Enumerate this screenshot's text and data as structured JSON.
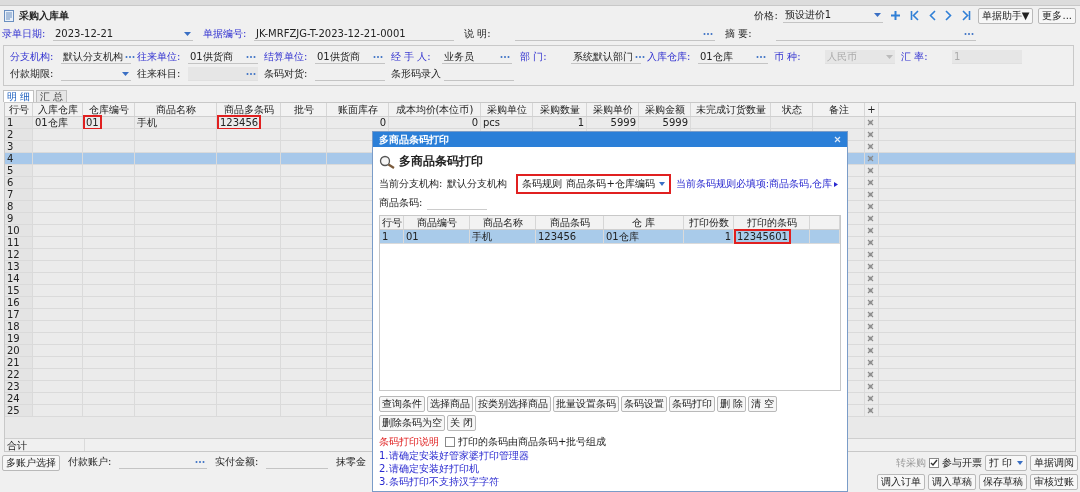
{
  "window": {
    "title": "采购入库单"
  },
  "toolbar": {
    "price_label": "价格:",
    "price_value": "预设进价1",
    "buttons": [
      "单据助手▼",
      "更多..."
    ]
  },
  "header_fields": [
    {
      "label": "录单日期:",
      "value": "2023-12-21",
      "kind": "dropdown",
      "linked": true,
      "disabled": false
    },
    {
      "label": "单据编号:",
      "value": "JK-MRFZJG-T-2023-12-21-0001",
      "kind": "text",
      "linked": true,
      "disabled": false
    },
    {
      "label": "说 明:",
      "kind": "lookup",
      "linked": false,
      "disabled": false
    },
    {
      "label": "摘 要:",
      "kind": "lookup",
      "linked": false,
      "disabled": false
    }
  ],
  "group_fields": [
    {
      "label": "分支机构:",
      "value": "默认分支机构",
      "kind": "lookup",
      "linked": true,
      "disabled": false
    },
    {
      "label": "往来单位:",
      "value": "01供货商",
      "kind": "lookup",
      "linked": true,
      "disabled": false
    },
    {
      "label": "结算单位:",
      "value": "01供货商",
      "kind": "lookup",
      "linked": true,
      "disabled": false
    },
    {
      "label": "经 手 人:",
      "value": "业务员",
      "kind": "lookup",
      "linked": true,
      "disabled": false
    },
    {
      "label": "部 门:",
      "value": "系统默认部门",
      "kind": "lookup",
      "linked": true,
      "disabled": false
    },
    {
      "label": "入库仓库:",
      "value": "01仓库",
      "kind": "lookup",
      "linked": true,
      "disabled": false
    },
    {
      "label": "币 种:",
      "value": "人民币",
      "kind": "dropdown",
      "linked": true,
      "disabled": true
    },
    {
      "label": "汇 率:",
      "value": "1",
      "kind": "text",
      "linked": true,
      "disabled": true
    },
    {
      "label": "付款期限:",
      "kind": "dropdown",
      "linked": false,
      "disabled": false
    },
    {
      "label": "往来科目:",
      "kind": "lookup",
      "linked": false,
      "disabled": true
    },
    {
      "label": "条码对货:",
      "kind": "text",
      "linked": false,
      "disabled": false
    },
    {
      "label": "条形码录入",
      "kind": "text",
      "linked": false,
      "disabled": false
    }
  ],
  "detail_tabs": [
    {
      "label": "明 细",
      "selected": true
    },
    {
      "label": "汇 总",
      "selected": false
    }
  ],
  "table": {
    "columns": [
      "行号",
      "入库仓库",
      "仓库编号",
      "商品名称",
      "商品多条码",
      "批号",
      "账面库存",
      "成本均价(本位币)",
      "采购单位",
      "采购数量",
      "采购单价",
      "采购金额",
      "未完成订货数量",
      "状态",
      "备注",
      "+"
    ],
    "rows": [
      {
        "cells": [
          "1",
          "01仓库",
          {
            "text": "01",
            "highlighted": true
          },
          "手机",
          {
            "text": "123456",
            "highlighted": true
          },
          null,
          "0",
          "0",
          "pcs",
          "1",
          "5999",
          "5999"
        ],
        "selected": false
      },
      {
        "cells": [
          "2"
        ],
        "selected": false
      },
      {
        "cells": [
          "3"
        ],
        "selected": false
      },
      {
        "cells": [
          "4"
        ],
        "selected": true
      },
      {
        "cells": [
          "5"
        ],
        "selected": false
      },
      {
        "cells": [
          "6"
        ],
        "selected": false
      },
      {
        "cells": [
          "7"
        ],
        "selected": false
      },
      {
        "cells": [
          "8"
        ],
        "selected": false
      },
      {
        "cells": [
          "9"
        ],
        "selected": false
      },
      {
        "cells": [
          "10"
        ],
        "selected": false
      },
      {
        "cells": [
          "11"
        ],
        "selected": false
      },
      {
        "cells": [
          "12"
        ],
        "selected": false
      },
      {
        "cells": [
          "13"
        ],
        "selected": false
      },
      {
        "cells": [
          "14"
        ],
        "selected": false
      },
      {
        "cells": [
          "15"
        ],
        "selected": false
      },
      {
        "cells": [
          "16"
        ],
        "selected": false
      },
      {
        "cells": [
          "17"
        ],
        "selected": false
      },
      {
        "cells": [
          "18"
        ],
        "selected": false
      },
      {
        "cells": [
          "19"
        ],
        "selected": false
      },
      {
        "cells": [
          "20"
        ],
        "selected": false
      },
      {
        "cells": [
          "21"
        ],
        "selected": false
      },
      {
        "cells": [
          "22"
        ],
        "selected": false
      },
      {
        "cells": [
          "23"
        ],
        "selected": false
      },
      {
        "cells": [
          "24"
        ],
        "selected": false
      },
      {
        "cells": [
          "25"
        ],
        "selected": false
      }
    ],
    "total_label": "合计"
  },
  "footer": {
    "account_button": "多账户选择",
    "fields": [
      {
        "label": "付款账户:",
        "kind": "lookup",
        "disabled": false
      },
      {
        "label": "实付金额:",
        "kind": "text",
        "disabled": false
      }
    ],
    "rounding_label": "抹零金",
    "side_label": "转采购",
    "invoice": {
      "label": "参与开票",
      "checked": true
    },
    "print_button": "打 印",
    "buttons": [
      "单据调阅",
      "调入订单",
      "调入草稿",
      "保存草稿",
      "审核过账"
    ]
  },
  "dialog": {
    "title": "多商品条码打印",
    "heading": "多商品条码打印",
    "branch_label": "当前分支机构:",
    "branch_value": "默认分支机构",
    "rule_label": "条码规则",
    "rule_value": "商品条码+仓库编码",
    "rule_highlighted": true,
    "rule_hint": "当前条码规则必填项:商品条码,仓库",
    "barcode_label": "商品条码:",
    "columns": [
      "行号",
      "商品编号",
      "商品名称",
      "商品条码",
      "仓 库",
      "打印份数",
      "打印的条码"
    ],
    "rows": [
      {
        "cells": [
          "1",
          "01",
          "手机",
          "123456",
          "01仓库",
          "1",
          {
            "text": "12345601",
            "highlighted": true
          }
        ],
        "selected": true
      }
    ],
    "buttons": [
      "查询条件",
      "选择商品",
      "按类别选择商品",
      "批量设置条码",
      "条码设置",
      "条码打印",
      "删 除",
      "清 空",
      "删除条码为空",
      "关 闭"
    ],
    "notes_title": "条码打印说明",
    "batch_option": {
      "label": "打印的条码由商品条码+批号组成",
      "checked": false
    },
    "notes": [
      "1.请确定安装好管家婆打印管理器",
      "2.请确定安装好打印机",
      "3.条码打印不支持汉字字符"
    ]
  }
}
